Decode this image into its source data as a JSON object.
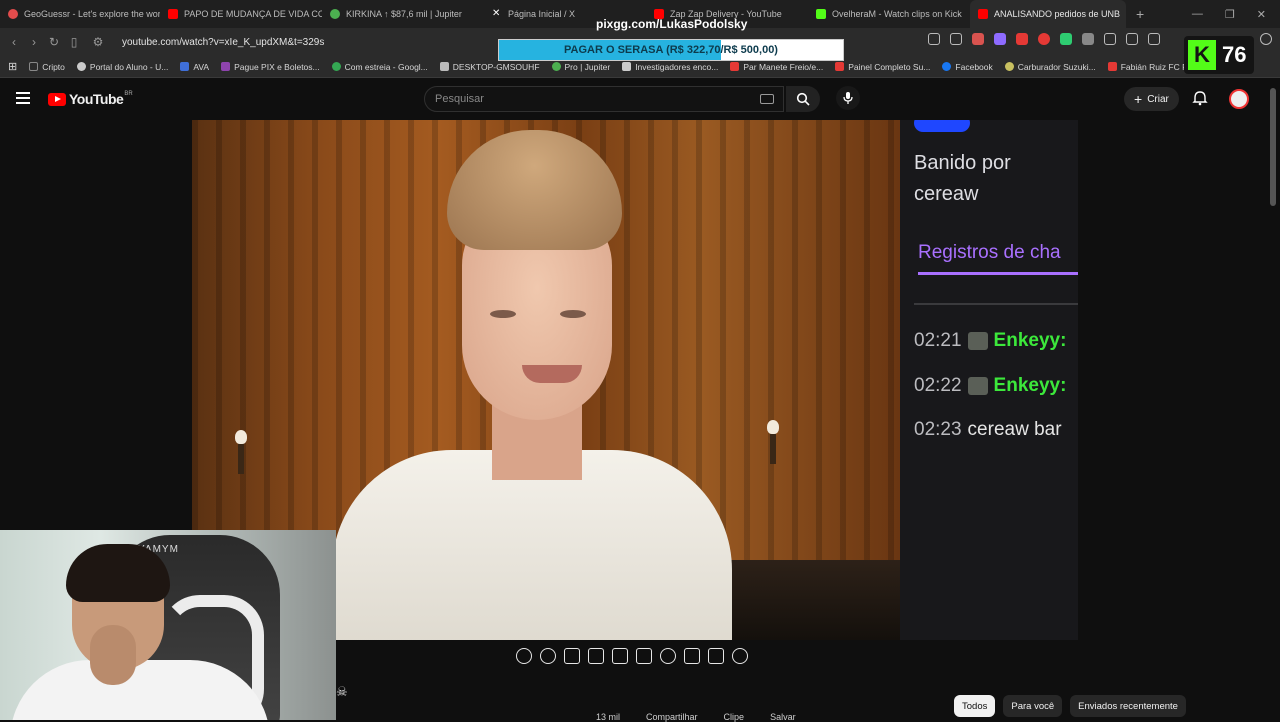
{
  "browser": {
    "tabs": [
      {
        "label": "GeoGuessr - Let's explore the world!",
        "color": "#e24c4c"
      },
      {
        "label": "PAPO DE MUDANÇA DE VIDA COM",
        "color": "#ff0000"
      },
      {
        "label": "KIRKINA ↑ $87,6 mil | Jupiter",
        "color": "#4caf50"
      },
      {
        "label": "Página Inicial / X",
        "color": "#ffffff"
      },
      {
        "label": "Zap Zap Delivery - YouTube",
        "color": "#ff0000"
      },
      {
        "label": "OvelheraM - Watch clips on Kick",
        "color": "#53fc18"
      },
      {
        "label": "ANALISANDO pedidos de UNB",
        "color": "#ff0000",
        "active": true
      }
    ],
    "url": "youtube.com/watch?v=xIe_K_updXM&t=329s",
    "bookmarks": [
      {
        "label": "Cripto",
        "color": "#888888"
      },
      {
        "label": "Portal do Aluno - U...",
        "color": "#cccccc"
      },
      {
        "label": "AVA",
        "color": "#3f6fd8"
      },
      {
        "label": "Pague PIX e Boletos...",
        "color": "#8e44ad"
      },
      {
        "label": "Com estreia - Googl...",
        "color": "#34a853"
      },
      {
        "label": "DESKTOP-GMSOUHF",
        "color": "#bbbbbb"
      },
      {
        "label": "Pro | Jupiter",
        "color": "#4caf50"
      },
      {
        "label": "Investigadores enco...",
        "color": "#cccccc"
      },
      {
        "label": "Par Manete Freio/e...",
        "color": "#e53935"
      },
      {
        "label": "Painel Completo Su...",
        "color": "#e53935"
      },
      {
        "label": "Facebook",
        "color": "#1877f2"
      },
      {
        "label": "Carburador Suzuki...",
        "color": "#c8c060"
      },
      {
        "label": "Fabián Ruiz FC Pro L...",
        "color": "#e53935"
      }
    ]
  },
  "overlay": {
    "pix_handle": "pixgg.com/LukasPodolsky",
    "goal_text": "PAGAR O SERASA (R$ 322,70/R$ 500,00)",
    "goal_progress": 0.6454,
    "kick_count": "76"
  },
  "youtube": {
    "logo_text": "YouTube",
    "country_code": "BR",
    "search_placeholder": "Pesquisar",
    "create_label": "Criar"
  },
  "stream_chat": {
    "banned_line1": "Banido por",
    "banned_line2": "cereaw",
    "logs_title": "Registros de cha",
    "messages": [
      {
        "time": "02:21",
        "user": "Enkeyy:"
      },
      {
        "time": "02:22",
        "user": "Enkeyy:"
      },
      {
        "time": "02:23",
        "text": "cereaw bar"
      }
    ]
  },
  "webcam": {
    "chair_logo": "YAMYM"
  },
  "chips": [
    {
      "label": "Todos",
      "active": true
    },
    {
      "label": "Para você"
    },
    {
      "label": "Enviados recentemente"
    }
  ],
  "actions": [
    "13 mil",
    "Compartilhar",
    "Clipe",
    "Salvar"
  ]
}
